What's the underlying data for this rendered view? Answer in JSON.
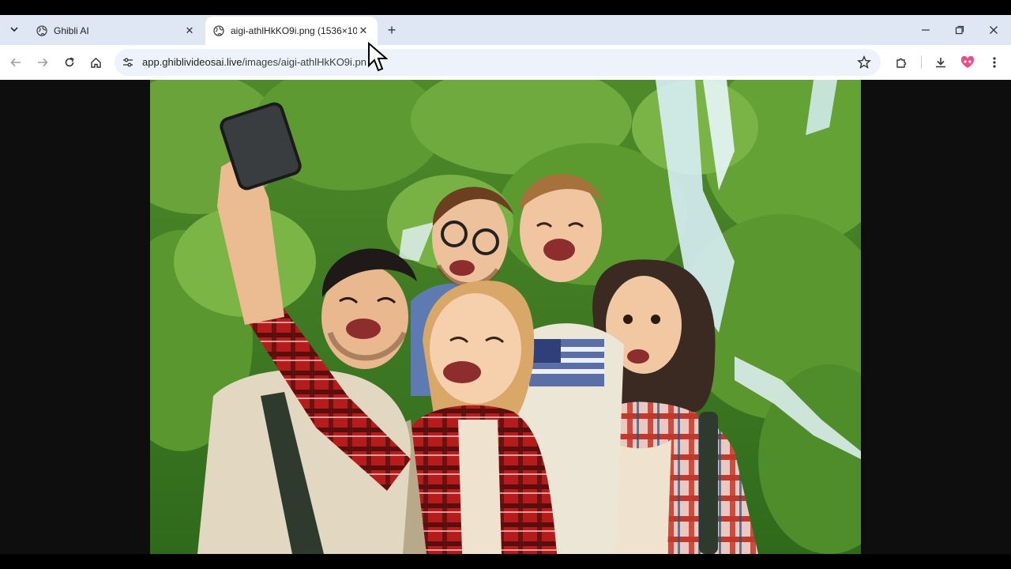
{
  "browser": {
    "tabs": [
      {
        "title": "Ghibli AI",
        "active": false
      },
      {
        "title": "aigi-athlHkKO9i.png (1536×102",
        "active": true
      }
    ],
    "url_host": "app.ghiblivideosai.live",
    "url_path": "/images/aigi-athlHkKO9i.pn",
    "icons": {
      "tab_search": "chevron-down-icon",
      "favicon": "globe-icon",
      "close": "close-icon",
      "new_tab": "plus-icon",
      "minimize": "minimize-icon",
      "restore": "restore-icon",
      "window_close": "close-icon",
      "back": "back-arrow-icon",
      "forward": "forward-arrow-icon",
      "reload": "reload-icon",
      "home": "home-icon",
      "site_info": "tune-icon",
      "bookmark": "star-icon",
      "extensions": "puzzle-icon",
      "downloads": "download-icon",
      "profile": "profile-avatar-icon",
      "menu": "kebab-menu-icon"
    },
    "colors": {
      "tabstrip_bg": "#dfe7f5",
      "toolbar_bg": "#ffffff",
      "omnibox_bg": "#eef2fa",
      "viewport_bg": "#0e0e0e"
    }
  },
  "content": {
    "image_description_type": "illustration",
    "colors": {
      "forest_dark": "#3f7a22",
      "forest_light": "#8bc34a",
      "waterfall": "#d7eef5",
      "plaid_red": "#c62828"
    }
  }
}
